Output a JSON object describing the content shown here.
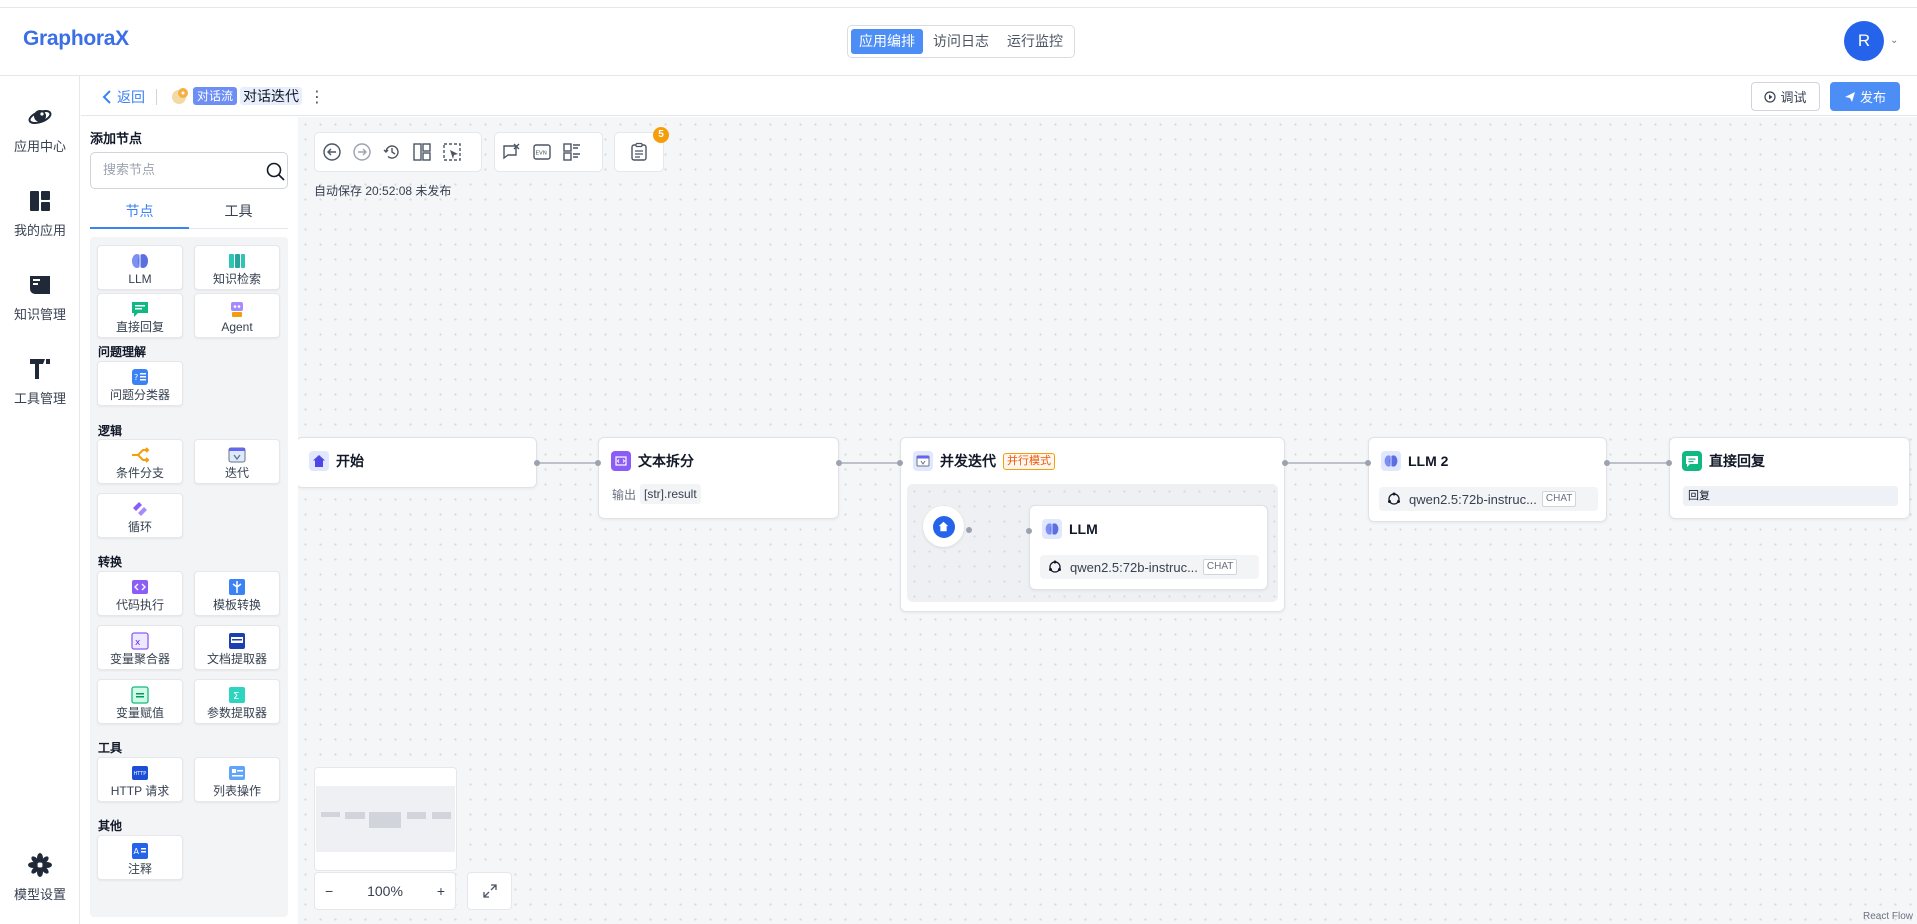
{
  "header": {
    "logo": "GraphoraX",
    "mode_tabs": [
      {
        "label": "应用编排",
        "active": true
      },
      {
        "label": "访问日志",
        "active": false
      },
      {
        "label": "运行监控",
        "active": false
      }
    ],
    "avatar_initial": "R"
  },
  "rail": {
    "items": [
      {
        "label": "应用中心",
        "icon": "planet-icon"
      },
      {
        "label": "我的应用",
        "icon": "dashboard-icon"
      },
      {
        "label": "知识管理",
        "icon": "book-icon"
      },
      {
        "label": "工具管理",
        "icon": "hammer-icon"
      }
    ],
    "bottom_item": {
      "label": "模型设置",
      "icon": "model-flower-icon"
    }
  },
  "subheader": {
    "back_label": "返回",
    "flow_type": "对话流",
    "flow_name": "对话迭代",
    "debug_label": "调试",
    "publish_label": "发布"
  },
  "panel": {
    "title": "添加节点",
    "search_placeholder": "搜索节点",
    "tabs": [
      {
        "label": "节点",
        "active": true
      },
      {
        "label": "工具",
        "active": false
      }
    ],
    "general": [
      {
        "label": "LLM",
        "icon": "brain-icon"
      },
      {
        "label": "知识检索",
        "icon": "books-icon"
      },
      {
        "label": "直接回复",
        "icon": "reply-icon"
      },
      {
        "label": "Agent",
        "icon": "agent-icon"
      }
    ],
    "categories": {
      "understanding": "问题理解",
      "logic": "逻辑",
      "transform": "转换",
      "tools": "工具",
      "other": "其他"
    },
    "understanding_nodes": [
      {
        "label": "问题分类器",
        "icon": "classifier-icon"
      }
    ],
    "logic_nodes": [
      {
        "label": "条件分支",
        "icon": "branch-icon"
      },
      {
        "label": "迭代",
        "icon": "iterate-icon"
      },
      {
        "label": "循环",
        "icon": "loop-icon"
      }
    ],
    "transform_nodes": [
      {
        "label": "代码执行",
        "icon": "code-icon"
      },
      {
        "label": "模板转换",
        "icon": "template-icon"
      },
      {
        "label": "变量聚合器",
        "icon": "variable-aggregator-icon"
      },
      {
        "label": "文档提取器",
        "icon": "doc-extractor-icon"
      },
      {
        "label": "变量赋值",
        "icon": "assign-icon"
      },
      {
        "label": "参数提取器",
        "icon": "param-extractor-icon"
      }
    ],
    "tool_nodes": [
      {
        "label": "HTTP 请求",
        "icon": "http-icon"
      },
      {
        "label": "列表操作",
        "icon": "list-op-icon"
      }
    ],
    "other_nodes": [
      {
        "label": "注释",
        "icon": "note-icon"
      }
    ]
  },
  "canvas": {
    "autosave": "自动保存 20:52:08 未发布",
    "checklist_count": "5",
    "nodes": {
      "start": {
        "title": "开始"
      },
      "split": {
        "title": "文本拆分",
        "output_label": "输出",
        "output_value": "[str].result"
      },
      "iteration": {
        "title": "并发迭代",
        "tag": "并行模式"
      },
      "inner_llm": {
        "title": "LLM",
        "model": "qwen2.5:72b-instruc...",
        "model_type": "CHAT"
      },
      "llm2": {
        "title": "LLM 2",
        "model": "qwen2.5:72b-instruc...",
        "model_type": "CHAT"
      },
      "reply": {
        "title": "直接回复",
        "content": "回复"
      }
    },
    "zoom": "100%",
    "attribution": "React Flow"
  },
  "colors": {
    "accent": "#4c8df6",
    "logo": "#3b6fe6",
    "tag_orange": "#ea580c",
    "badge": "#f59e0b"
  }
}
